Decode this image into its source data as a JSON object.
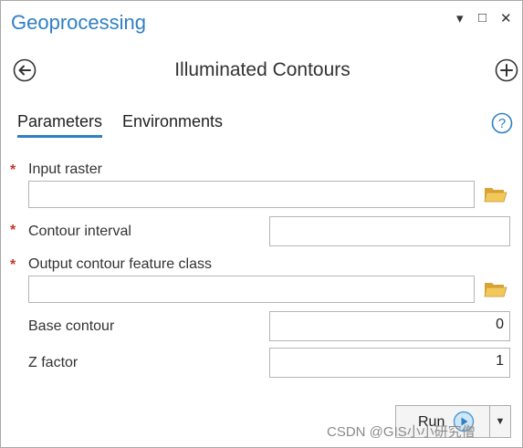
{
  "pane": {
    "title": "Geoprocessing",
    "controls": {
      "menu": "▾",
      "maximize": "□",
      "close": "✕"
    }
  },
  "tool": {
    "title": "Illuminated Contours"
  },
  "tabs": [
    {
      "label": "Parameters",
      "active": true
    },
    {
      "label": "Environments",
      "active": false
    }
  ],
  "params": {
    "input_raster": {
      "label": "Input raster",
      "required": "*",
      "value": ""
    },
    "contour_interval": {
      "label": "Contour interval",
      "required": "*",
      "value": ""
    },
    "output_contour": {
      "label": "Output contour feature class",
      "required": "*",
      "value": ""
    },
    "base_contour": {
      "label": "Base contour",
      "value": "0"
    },
    "z_factor": {
      "label": "Z factor",
      "value": "1"
    }
  },
  "run": {
    "label": "Run",
    "dropdown": "▼"
  },
  "watermark": "CSDN @GIS小小研究僧",
  "colors": {
    "accent": "#2f7fc4",
    "required": "#c0392b",
    "folder": "#e8b84a"
  },
  "icons": [
    "back-arrow-icon",
    "add-icon",
    "help-icon",
    "folder-icon",
    "play-icon"
  ]
}
